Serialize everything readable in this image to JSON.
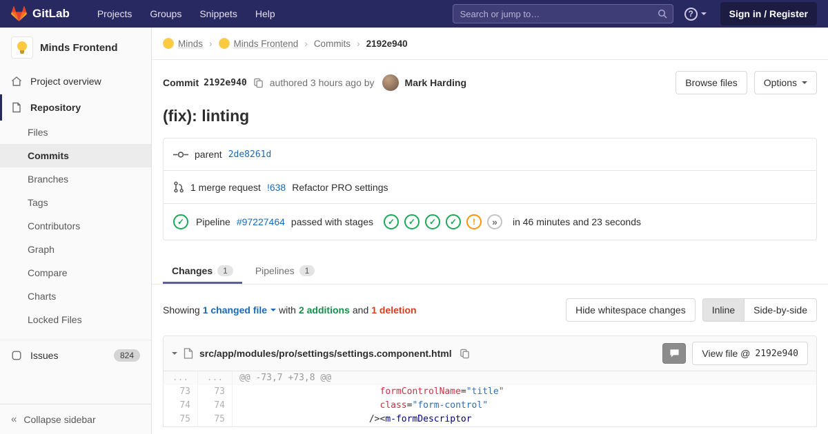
{
  "colors": {
    "navbar_bg": "#292961",
    "logo_orange": "#fc6d26",
    "link_blue": "#1b69b6",
    "success_green": "#1aaa55",
    "warning_orange": "#fc9403",
    "danger_red": "#db3b21",
    "active_tab_indigo": "#5c5cad"
  },
  "icons": {
    "help_glyph": "?",
    "collapse_glyph": "«",
    "check_glyph": "✓",
    "warn_glyph": "!",
    "more_glyph": "»"
  },
  "navbar": {
    "brand": "GitLab",
    "links": [
      "Projects",
      "Groups",
      "Snippets",
      "Help"
    ],
    "search_placeholder": "Search or jump to…",
    "sign_in": "Sign in / Register"
  },
  "sidebar": {
    "project_name": "Minds Frontend",
    "overview": "Project overview",
    "repository": "Repository",
    "repo_items": [
      "Files",
      "Commits",
      "Branches",
      "Tags",
      "Contributors",
      "Graph",
      "Compare",
      "Charts",
      "Locked Files"
    ],
    "issues": "Issues",
    "issues_count": "824",
    "collapse": "Collapse sidebar"
  },
  "breadcrumb": {
    "group": "Minds",
    "project": "Minds Frontend",
    "section": "Commits",
    "current": "2192e940",
    "separator": "›"
  },
  "commit": {
    "label": "Commit",
    "sha": "2192e940",
    "authored": "authored 3 hours ago by",
    "author": "Mark Harding",
    "browse_files": "Browse files",
    "options": "Options",
    "title": "(fix): linting",
    "parent_label": "parent",
    "parent_sha": "2de8261d",
    "mr_text": "1 merge request",
    "mr_ref": "!638",
    "mr_title": "Refactor PRO settings",
    "pipeline_label": "Pipeline",
    "pipeline_id": "#97227464",
    "pipeline_status": "passed with stages",
    "pipeline_duration": "in 46 minutes and 23 seconds"
  },
  "tabs": {
    "changes": "Changes",
    "changes_count": "1",
    "pipelines": "Pipelines",
    "pipelines_count": "1"
  },
  "summary": {
    "showing": "Showing",
    "changed_file": "1 changed file",
    "with_text": "with",
    "additions": "2 additions",
    "and_text": "and",
    "deletions": "1 deletion",
    "hide_whitespace": "Hide whitespace changes",
    "inline": "Inline",
    "side_by_side": "Side-by-side"
  },
  "file": {
    "path": "src/app/modules/pro/settings/settings.component.html",
    "view_file": "View file @",
    "view_sha": "2192e940"
  },
  "diff": {
    "gutter_skip": "...",
    "hunk": "@@ -73,7 +73,8 @@",
    "lines": [
      {
        "old": "73",
        "new": "73",
        "indent": "                          ",
        "attr": "formControlName",
        "eq": "=",
        "value": "\"title\""
      },
      {
        "old": "74",
        "new": "74",
        "indent": "                          ",
        "attr": "class",
        "eq": "=",
        "value": "\"form-control\""
      },
      {
        "old": "75",
        "new": "75",
        "indent": "                        ",
        "punct": "/><",
        "tag": "m-formDescriptor"
      }
    ]
  }
}
